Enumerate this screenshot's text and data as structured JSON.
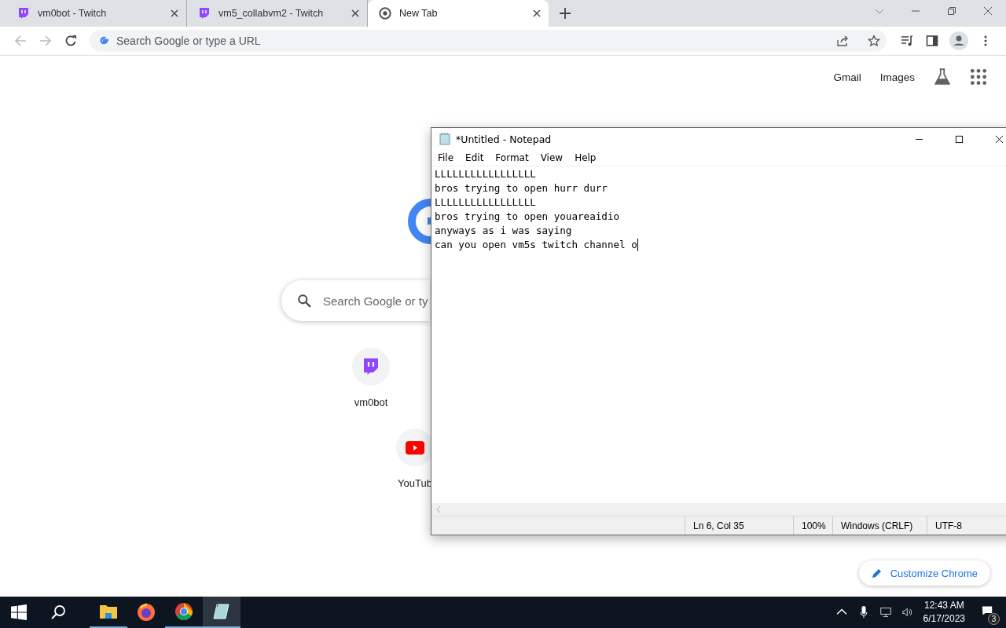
{
  "browser": {
    "tabs": [
      {
        "title": "vm0bot - Twitch",
        "kind": "twitch",
        "selected": false
      },
      {
        "title": "vm5_collabvm2 - Twitch",
        "kind": "twitch",
        "selected": false
      },
      {
        "title": "New Tab",
        "kind": "chrome",
        "selected": true
      }
    ],
    "address": {
      "placeholder": "Search Google or type a URL"
    },
    "links": [
      "Gmail",
      "Images"
    ],
    "search": {
      "placeholder": "Search Google or ty"
    },
    "shortcuts": [
      {
        "label": "vm0bot",
        "kind": "twitch"
      },
      {
        "label": "YouTub",
        "kind": "youtube"
      }
    ],
    "customize": "Customize Chrome"
  },
  "notepad": {
    "title": "*Untitled - Notepad",
    "menu": [
      "File",
      "Edit",
      "Format",
      "View",
      "Help"
    ],
    "lines": [
      "LLLLLLLLLLLLLLLLL",
      "bros trying to open hurr durr",
      "LLLLLLLLLLLLLLLLL",
      "bros trying to open youareaidio",
      "anyways as i was saying",
      "can you open vm5s twitch channel o"
    ],
    "status": [
      "Ln 6, Col 35",
      "100%",
      "Windows (CRLF)",
      "UTF-8"
    ]
  },
  "taskbar": {
    "apps": [
      {
        "kind": "explorer",
        "running": true,
        "selected": false
      },
      {
        "kind": "firefox",
        "running": false,
        "selected": false
      },
      {
        "kind": "chrome",
        "running": true,
        "selected": false
      },
      {
        "kind": "notepad",
        "running": true,
        "selected": true
      }
    ],
    "time": "12:43 AM",
    "date": "6/17/2023",
    "notifications": "3"
  }
}
